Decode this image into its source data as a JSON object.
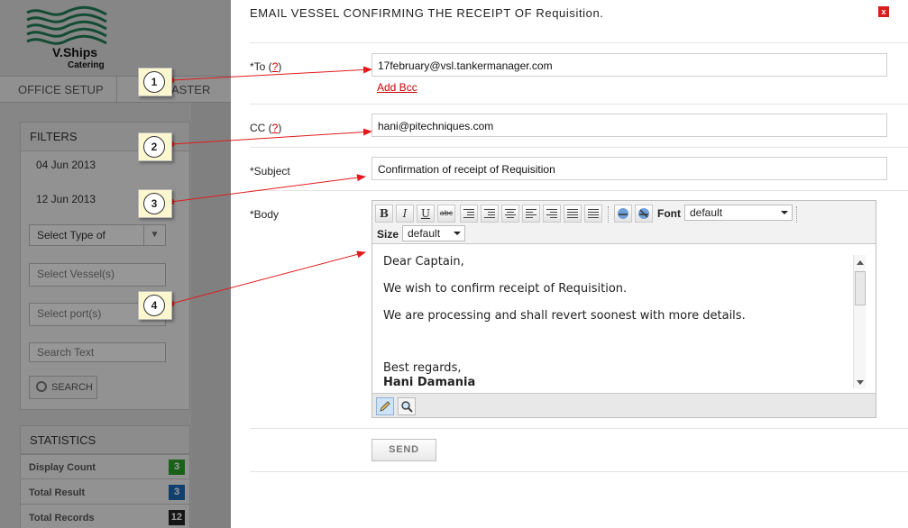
{
  "background_app": {
    "logo_title": "V.Ships",
    "logo_subtitle": "Catering",
    "tabs": [
      "OFFICE SETUP",
      "ASTER"
    ],
    "filters": {
      "title": "FILTERS",
      "date_from": "04 Jun 2013",
      "date_to": "12 Jun 2013",
      "type_select": "Select Type of",
      "vessel_placeholder": "Select Vessel(s)",
      "port_placeholder": "Select port(s)",
      "search_text_placeholder": "Search Text",
      "search_button": "SEARCH"
    },
    "statistics": {
      "title": "STATISTICS",
      "rows": [
        {
          "label": "Display Count",
          "value": "3",
          "color": "#2a9d2a"
        },
        {
          "label": "Total Result",
          "value": "3",
          "color": "#1f67b1"
        },
        {
          "label": "Total Records",
          "value": "12",
          "color": "#222222"
        }
      ]
    }
  },
  "dialog": {
    "title": "EMAIL VESSEL CONFIRMING THE RECEIPT OF Requisition.",
    "close_label": "x",
    "to": {
      "label": "*To (",
      "help": "?",
      "suffix": ")",
      "value": "17february@vsl.tankermanager.com"
    },
    "add_bcc": "Add Bcc",
    "cc": {
      "label": "CC (",
      "help": "?",
      "suffix": ")",
      "value": "hani@pitechniques.com"
    },
    "subject": {
      "label": "*Subject",
      "value": "Confirmation of receipt of Requisition"
    },
    "body": {
      "label": "*Body",
      "paragraphs": [
        "Dear Captain,",
        "We wish to confirm receipt of Requisition.",
        "We are processing and shall revert soonest with more details.",
        "Best regards,",
        "Hani Damania"
      ]
    },
    "toolbar": {
      "bold": "B",
      "italic": "I",
      "underline": "U",
      "strike": "abc",
      "font_label": "Font",
      "font_value": "default",
      "size_label": "Size",
      "size_value": "default"
    },
    "send_label": "SEND"
  },
  "callouts": [
    "1",
    "2",
    "3",
    "4"
  ],
  "colors": {
    "accent_red": "#d71f1f",
    "link_red": "#cc0000",
    "callout_bg": "#fdf7d0"
  }
}
